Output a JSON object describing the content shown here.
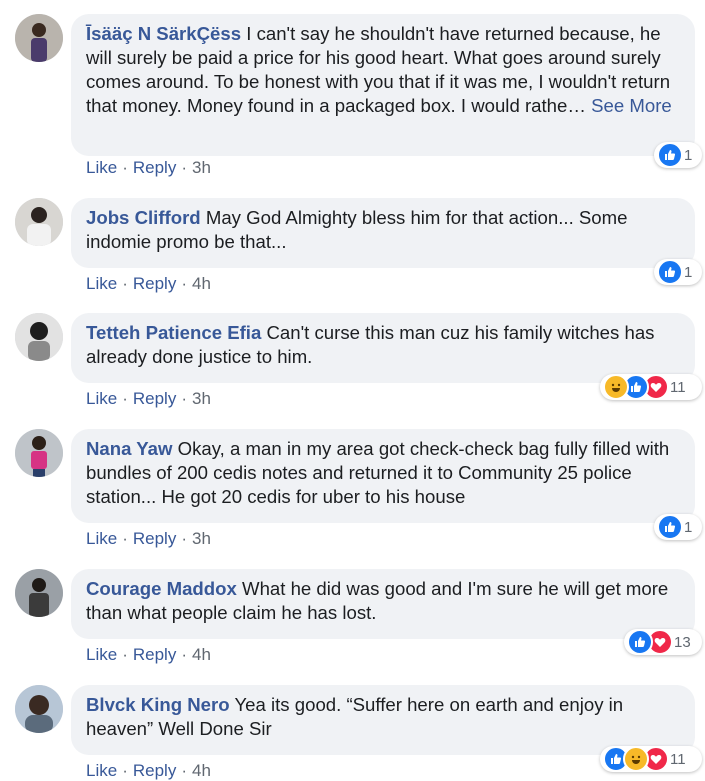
{
  "colors": {
    "author": "#385898",
    "bubble": "#f0f2f5",
    "like": "#1877f2",
    "love": "#f02849",
    "haha": "#f7b928"
  },
  "actions": {
    "like": "Like",
    "reply": "Reply",
    "sep": "·"
  },
  "comments": [
    {
      "author": "Īsääç N SärkÇëss",
      "text": "I can't say he shouldn't have returned because, he will surely be paid a price for his good heart. What goes around surely comes around. To be honest with you that if it was me, I wouldn't return that money. Money found in a packaged box. I would rathe…",
      "see_more": "See More",
      "time": "3h",
      "reactions": [
        "like-icon"
      ],
      "count": "1"
    },
    {
      "author": "Jobs Clifford",
      "text": "May God Almighty bless him for that action... Some indomie promo be that...",
      "time": "4h",
      "reactions": [
        "like-icon"
      ],
      "count": "1"
    },
    {
      "author": "Tetteh Patience Efia",
      "text": "Can't curse this man cuz his family witches has already done justice to him.",
      "time": "3h",
      "reactions": [
        "haha-icon",
        "like-icon",
        "love-icon"
      ],
      "count": "11"
    },
    {
      "author": "Nana Yaw",
      "text": "Okay, a man in my area got check-check bag fully filled with bundles of 200 cedis notes and returned it to Community 25 police station... He got 20 cedis for uber to his house",
      "time": "3h",
      "reactions": [
        "like-icon"
      ],
      "count": "1"
    },
    {
      "author": "Courage Maddox",
      "text": "What he did was good and I'm sure he will get more than what people claim he has lost.",
      "time": "4h",
      "reactions": [
        "like-icon",
        "love-icon"
      ],
      "count": "13"
    },
    {
      "author": "Blvck King Nero",
      "text": "Yea its good. “Suffer here on earth and enjoy in heaven” Well Done Sir",
      "time": "4h",
      "reactions": [
        "like-icon",
        "haha-icon",
        "love-icon"
      ],
      "count": "11"
    }
  ]
}
